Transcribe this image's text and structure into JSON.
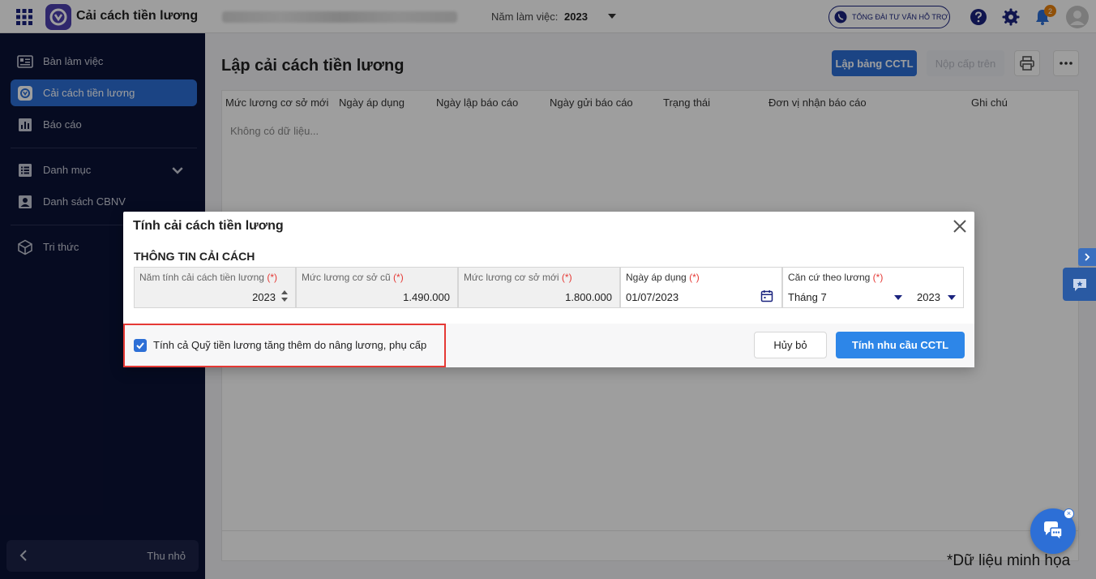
{
  "topbar": {
    "app_title": "Cải cách tiền lương",
    "year_label": "Năm làm việc:",
    "year_value": "2023",
    "support_label": "TỔNG ĐÀI TƯ VẤN HỖ TRỢ",
    "notification_count": "2"
  },
  "sidebar": {
    "items": [
      {
        "label": "Bàn làm việc",
        "icon": "dashboard-icon"
      },
      {
        "label": "Cải cách tiền lương",
        "icon": "salary-reform-icon"
      },
      {
        "label": "Báo cáo",
        "icon": "report-icon"
      },
      {
        "label": "Danh mục",
        "icon": "list-icon"
      },
      {
        "label": "Danh sách CBNV",
        "icon": "employee-list-icon"
      },
      {
        "label": "Tri thức",
        "icon": "knowledge-icon"
      }
    ],
    "collapse_label": "Thu nhỏ"
  },
  "main": {
    "page_title": "Lập cải cách tiền lương",
    "create_button": "Lập bảng CCTL",
    "submit_upper_button": "Nộp cấp trên",
    "table": {
      "headers": [
        "Mức lương cơ sở mới",
        "Ngày áp dụng",
        "Ngày lập báo cáo",
        "Ngày gửi báo cáo",
        "Trạng thái",
        "Đơn vị nhận báo cáo",
        "Ghi chú"
      ],
      "empty_text": "Không có dữ liệu..."
    }
  },
  "dialog": {
    "title": "Tính cải cách tiền lương",
    "section_title": "THÔNG TIN CẢI CÁCH",
    "required_mark": "(*)",
    "fields": {
      "calc_year": {
        "label": "Năm tính cải cách tiền lương",
        "value": "2023"
      },
      "old_base_salary": {
        "label": "Mức lương cơ sở cũ",
        "value": "1.490.000"
      },
      "new_base_salary": {
        "label": "Mức lương cơ sở mới",
        "value": "1.800.000"
      },
      "apply_date": {
        "label": "Ngày áp dụng",
        "value": "01/07/2023"
      },
      "salary_basis": {
        "label": "Căn cứ theo lương",
        "month_value": "Tháng 7",
        "year_value": "2023"
      }
    },
    "checkbox_label": "Tính cả Quỹ tiền lương tăng thêm do nâng lương, phụ cấp",
    "checkbox_checked": true,
    "cancel_button": "Hủy bỏ",
    "submit_button": "Tính nhu cầu CCTL"
  },
  "note": "*Dữ liệu minh họa",
  "colors": {
    "primary": "#2d6fd6",
    "sidebar_bg": "#0b1236",
    "highlight": "#e53935",
    "badge": "#e8820e"
  }
}
